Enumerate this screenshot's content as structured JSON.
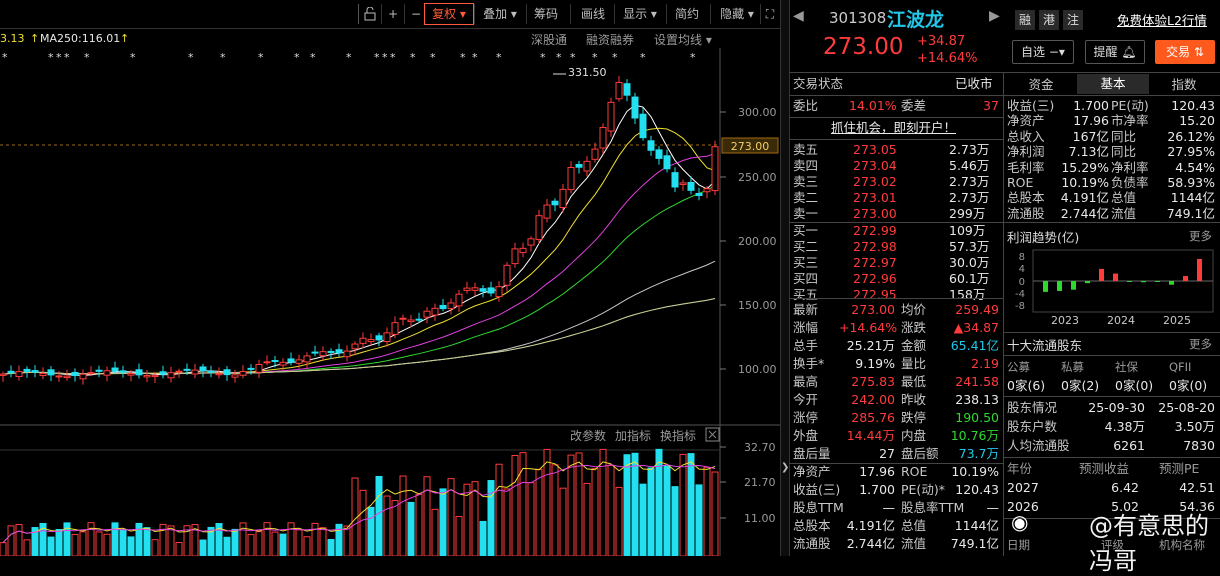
{
  "toolbar": {
    "items": [
      "复权",
      "叠加",
      "筹码",
      "画线",
      "显示",
      "简约",
      "隐藏"
    ],
    "selected": "复权",
    "icons": [
      "lock-icon",
      "plus-icon",
      "minus-icon"
    ],
    "fullscreen_icon": "fullscreen-icon"
  },
  "ma_legend": {
    "prefix": "3.13",
    "ma250": "MA250:116.01",
    "links": [
      "深股通",
      "融资融券",
      "设置均线"
    ]
  },
  "main_chart": {
    "y_ticks": [
      "300.00",
      "250.00",
      "200.00",
      "150.00",
      "100.00"
    ],
    "current_price_tag": "273.00",
    "high_label": "331.50"
  },
  "volume_chart": {
    "links": [
      "改参数",
      "加指标",
      "换指标"
    ],
    "y_ticks": [
      "32.70",
      "21.70",
      "11.00"
    ]
  },
  "stock": {
    "code": "301308",
    "name": "江波龙",
    "price": "273.00",
    "change": "+34.87",
    "change_pct": "+14.64%",
    "tags": [
      "融",
      "港",
      "注"
    ],
    "promo": "免费体验L2行情",
    "self_select": "自选",
    "remind": "提醒",
    "trade": "交易"
  },
  "status": {
    "label": "交易状态",
    "value": "已收市",
    "webi_label": "委比",
    "webi": "14.01%",
    "weicha_label": "委差",
    "weicha": "37",
    "ad": "抓住机会，即刻开户！"
  },
  "orderbook": {
    "sell": [
      {
        "label": "卖五",
        "price": "273.05",
        "vol": "2.73万"
      },
      {
        "label": "卖四",
        "price": "273.04",
        "vol": "5.46万"
      },
      {
        "label": "卖三",
        "price": "273.02",
        "vol": "2.73万"
      },
      {
        "label": "卖二",
        "price": "273.01",
        "vol": "2.73万"
      },
      {
        "label": "卖一",
        "price": "273.00",
        "vol": "299万"
      }
    ],
    "buy": [
      {
        "label": "买一",
        "price": "272.99",
        "vol": "109万"
      },
      {
        "label": "买二",
        "price": "272.98",
        "vol": "57.3万"
      },
      {
        "label": "买三",
        "price": "272.97",
        "vol": "30.0万"
      },
      {
        "label": "买四",
        "price": "272.96",
        "vol": "60.1万"
      },
      {
        "label": "买五",
        "price": "272.95",
        "vol": "158万"
      }
    ]
  },
  "quote": [
    {
      "l1": "最新",
      "v1": "273.00",
      "c1": "red",
      "l2": "均价",
      "v2": "259.49",
      "c2": "red"
    },
    {
      "l1": "涨幅",
      "v1": "+14.64%",
      "c1": "red",
      "l2": "涨跌",
      "v2": "▲34.87",
      "c2": "red"
    },
    {
      "l1": "总手",
      "v1": "25.21万",
      "c1": "white",
      "l2": "金额",
      "v2": "65.41亿",
      "c2": "cyan"
    },
    {
      "l1": "换手*",
      "v1": "9.19%",
      "c1": "white",
      "l2": "量比",
      "v2": "2.19",
      "c2": "red"
    },
    {
      "l1": "最高",
      "v1": "275.83",
      "c1": "red",
      "l2": "最低",
      "v2": "241.58",
      "c2": "red"
    },
    {
      "l1": "今开",
      "v1": "242.00",
      "c1": "red",
      "l2": "昨收",
      "v2": "238.13",
      "c2": "white"
    },
    {
      "l1": "涨停",
      "v1": "285.76",
      "c1": "red",
      "l2": "跌停",
      "v2": "190.50",
      "c2": "green"
    },
    {
      "l1": "外盘",
      "v1": "14.44万",
      "c1": "red",
      "l2": "内盘",
      "v2": "10.76万",
      "c2": "green"
    },
    {
      "l1": "盘后量",
      "v1": "27",
      "c1": "white",
      "l2": "盘后额",
      "v2": "73.7万",
      "c2": "cyan"
    },
    {
      "l1": "净资产",
      "v1": "17.96",
      "c1": "white",
      "l2": "ROE",
      "v2": "10.19%",
      "c2": "white"
    },
    {
      "l1": "收益(三)",
      "v1": "1.700",
      "c1": "white",
      "l2": "PE(动)*",
      "v2": "120.43",
      "c2": "white"
    },
    {
      "l1": "股息TTM",
      "v1": "—",
      "c1": "white",
      "l2": "股息率TTM",
      "v2": "—",
      "c2": "white"
    },
    {
      "l1": "总股本",
      "v1": "4.191亿",
      "c1": "white",
      "l2": "总值",
      "v2": "1144亿",
      "c2": "white"
    },
    {
      "l1": "流通股",
      "v1": "2.744亿",
      "c1": "white",
      "l2": "流值",
      "v2": "749.1亿",
      "c2": "white"
    }
  ],
  "fundamentals": {
    "tabs": [
      "资金",
      "基本",
      "指数"
    ],
    "active_tab": "基本",
    "rows": [
      {
        "l1": "收益(三)",
        "v1": "1.700",
        "l2": "PE(动)",
        "v2": "120.43"
      },
      {
        "l1": "净资产",
        "v1": "17.96",
        "l2": "市净率",
        "v2": "15.20"
      },
      {
        "l1": "总收入",
        "v1": "167亿",
        "l2": "同比",
        "v2": "26.12%"
      },
      {
        "l1": "净利润",
        "v1": "7.13亿",
        "l2": "同比",
        "v2": "27.95%"
      },
      {
        "l1": "毛利率",
        "v1": "15.29%",
        "l2": "净利率",
        "v2": "4.54%"
      },
      {
        "l1": "ROE",
        "v1": "10.19%",
        "l2": "负债率",
        "v2": "58.93%"
      },
      {
        "l1": "总股本",
        "v1": "4.191亿",
        "l2": "总值",
        "v2": "1144亿"
      },
      {
        "l1": "流通股",
        "v1": "2.744亿",
        "l2": "流值",
        "v2": "749.1亿"
      }
    ]
  },
  "profit_trend": {
    "title": "利润趋势(亿)",
    "more": "更多",
    "y_ticks": [
      "8",
      "4",
      "0",
      "-4",
      "-8"
    ],
    "years": [
      "2023",
      "2024",
      "2025"
    ],
    "bars": [
      -3.5,
      -3.2,
      -2.8,
      -0.7,
      3.9,
      2.4,
      -0.3,
      -0.4,
      -0.2,
      -1.2,
      1.6,
      7.1
    ]
  },
  "holders": {
    "title": "十大流通股东",
    "more": "更多",
    "headers": [
      "公募",
      "私募",
      "社保",
      "QFII"
    ],
    "counts": [
      "0家(6)",
      "0家(2)",
      "0家(0)",
      "0家(0)"
    ],
    "rows": [
      {
        "label": "股东情况",
        "v1": "25-09-30",
        "v2": "25-08-20"
      },
      {
        "label": "股东户数",
        "v1": "4.38万",
        "v2": "3.50万"
      },
      {
        "label": "人均流通股",
        "v1": "6261",
        "v2": "7830"
      }
    ]
  },
  "forecast": {
    "headers": [
      "年份",
      "预测收益",
      "预测PE"
    ],
    "rows": [
      {
        "year": "2027",
        "eps": "6.42",
        "pe": "42.51"
      },
      {
        "year": "2026",
        "eps": "5.02",
        "pe": "54.36"
      }
    ],
    "footer": [
      "日期",
      "评级",
      "机构名称"
    ]
  },
  "watermark": "@有意思的冯哥",
  "colors": {
    "up": "#ff3b3b",
    "down": "#22e0f0",
    "accent": "#ff5a3c",
    "bg": "#000000"
  }
}
